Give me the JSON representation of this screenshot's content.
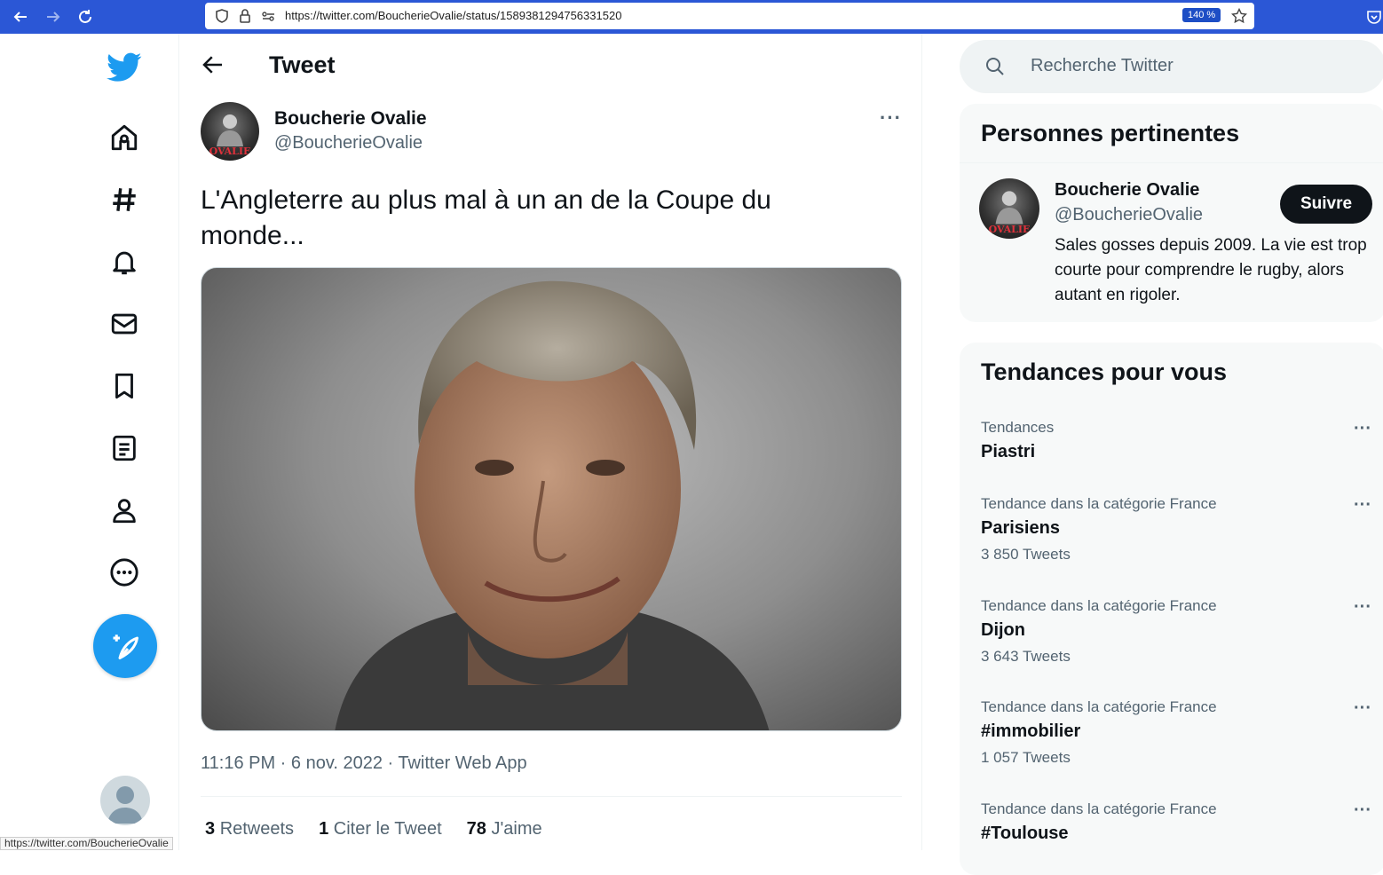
{
  "browser": {
    "url": "https://twitter.com/BoucherieOvalie/status/1589381294756331520",
    "zoom": "140 %",
    "status_url": "https://twitter.com/BoucherieOvalie"
  },
  "header": {
    "title": "Tweet"
  },
  "tweet": {
    "author_name": "Boucherie Ovalie",
    "author_handle": "@BoucherieOvalie",
    "avatar_text": "OVALIE",
    "text": "L'Angleterre au plus mal à un an de la Coupe du monde...",
    "meta": "11:16 PM · 6 nov. 2022 · Twitter Web App",
    "retweets_count": "3",
    "retweets_label": "Retweets",
    "quotes_count": "1",
    "quotes_label": "Citer le Tweet",
    "likes_count": "78",
    "likes_label": "J'aime"
  },
  "search": {
    "placeholder": "Recherche Twitter"
  },
  "relevant": {
    "title": "Personnes pertinentes",
    "name": "Boucherie Ovalie",
    "handle": "@BoucherieOvalie",
    "bio": "Sales gosses depuis 2009. La vie est trop courte pour comprendre le rugby, alors autant en rigoler.",
    "follow_label": "Suivre"
  },
  "trends": {
    "title": "Tendances pour vous",
    "items": [
      {
        "category": "Tendances",
        "name": "Piastri",
        "count": ""
      },
      {
        "category": "Tendance dans la catégorie France",
        "name": "Parisiens",
        "count": "3 850 Tweets"
      },
      {
        "category": "Tendance dans la catégorie France",
        "name": "Dijon",
        "count": "3 643 Tweets"
      },
      {
        "category": "Tendance dans la catégorie France",
        "name": "#immobilier",
        "count": "1 057 Tweets"
      },
      {
        "category": "Tendance dans la catégorie France",
        "name": "#Toulouse",
        "count": ""
      }
    ]
  },
  "colors": {
    "accent": "#1d9bf0",
    "browser_bar": "#2b57d6"
  }
}
